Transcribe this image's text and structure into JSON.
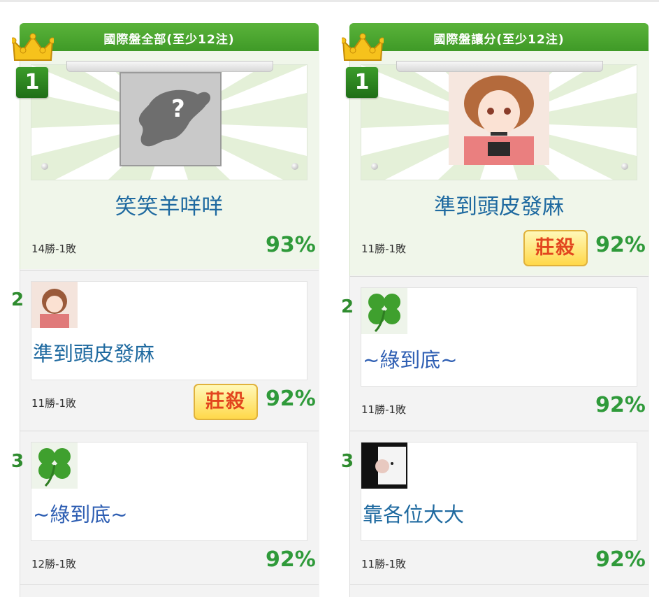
{
  "left": {
    "title": "國際盤全部(至少12注)",
    "first": {
      "rank": "1",
      "name": "笑笑羊咩咩",
      "record": "14勝-1敗",
      "pct": "93%"
    },
    "second": {
      "rank": "2",
      "name": "準到頭皮發麻",
      "record": "11勝-1敗",
      "pct": "92%",
      "badge": "莊殺"
    },
    "third": {
      "rank": "3",
      "name": "~綠到底~",
      "record": "12勝-1敗",
      "pct": "92%"
    }
  },
  "right": {
    "title": "國際盤讓分(至少12注)",
    "first": {
      "rank": "1",
      "name": "準到頭皮發麻",
      "record": "11勝-1敗",
      "pct": "92%",
      "badge": "莊殺"
    },
    "second": {
      "rank": "2",
      "name": "~綠到底~",
      "record": "11勝-1敗",
      "pct": "92%"
    },
    "third": {
      "rank": "3",
      "name": "靠各位大大",
      "record": "11勝-1敗",
      "pct": "92%"
    }
  },
  "colors": {
    "ribbon": "#4aa832",
    "name": "#1f6aa0",
    "pct": "#2f9a3a",
    "badge_text": "#e2451e"
  },
  "icons": [
    "crown-icon",
    "question-silhouette-icon",
    "clover-icon",
    "anime-avatar-icon",
    "portrait-avatar-icon"
  ]
}
